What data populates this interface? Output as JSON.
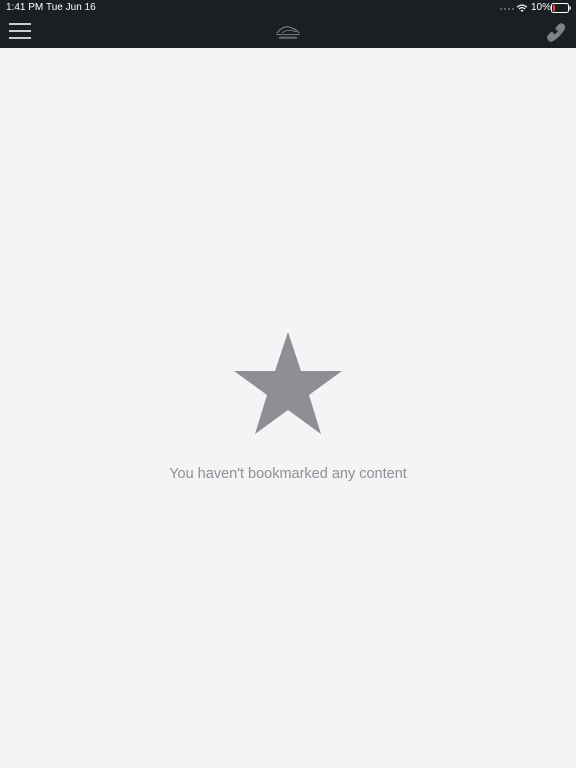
{
  "status_bar": {
    "time": "1:41 PM",
    "date": "Tue Jun 16",
    "battery_percent": "10%",
    "wifi_icon": "wifi-icon",
    "battery_icon": "battery-icon"
  },
  "navbar": {
    "menu_icon": "hamburger-menu-icon",
    "logo_icon": "app-logo",
    "call_icon": "phone-icon"
  },
  "empty_state": {
    "icon": "star-icon",
    "message": "You haven't bookmarked any content"
  },
  "colors": {
    "topbar_bg": "#1c1f22",
    "page_bg": "#f4f4f6",
    "star": "#8e8e93",
    "message_text": "#8f9094"
  }
}
